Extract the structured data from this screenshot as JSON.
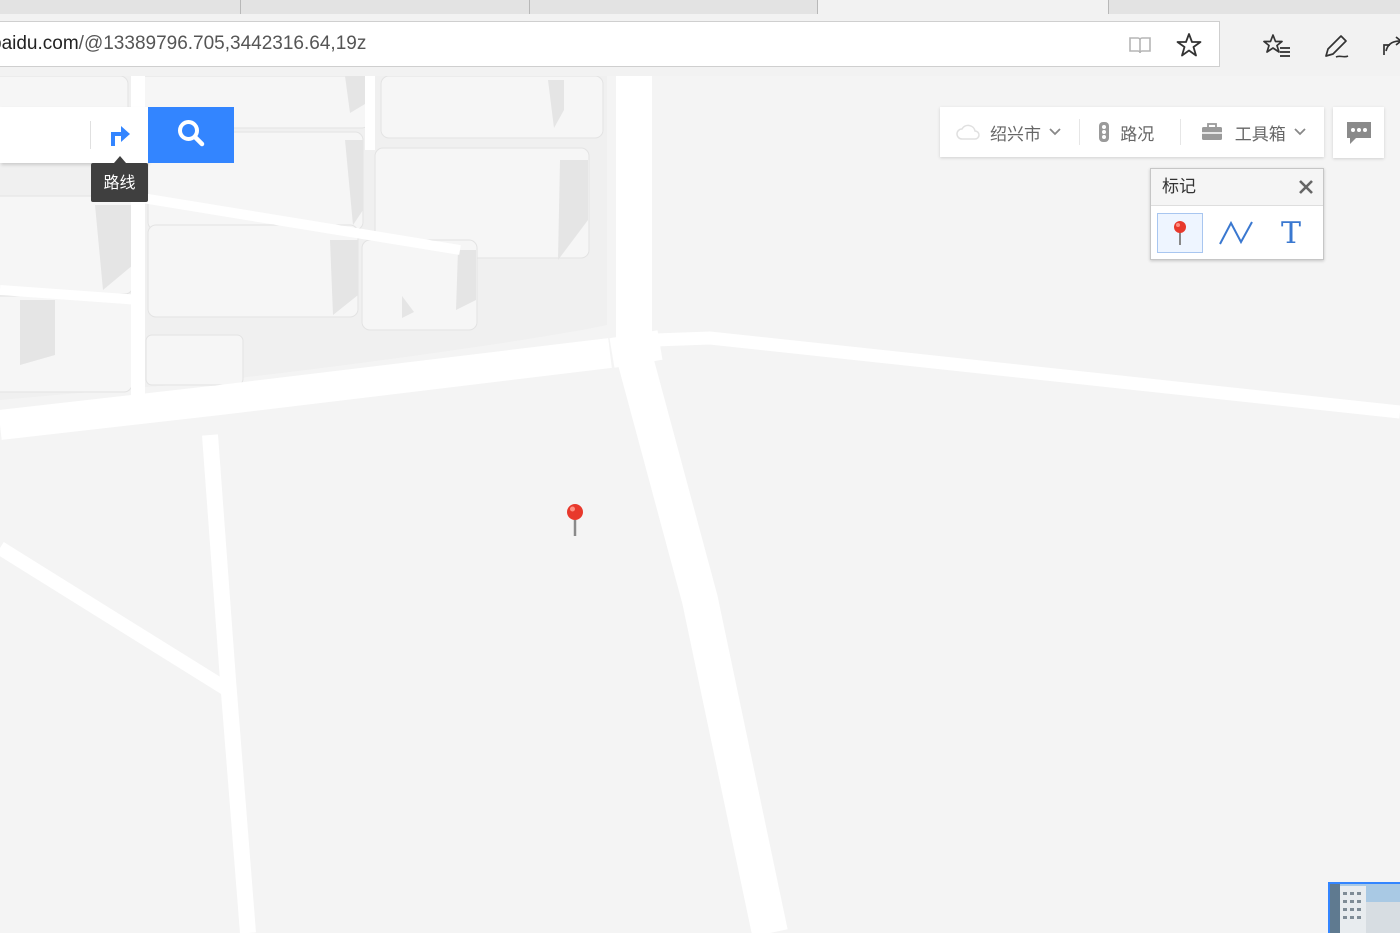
{
  "browser": {
    "url_host": "baidu.com",
    "url_path": "/@13389796.705,3442316.64,19z"
  },
  "search": {
    "input_value": "",
    "route_tooltip": "路线"
  },
  "toolbar": {
    "city": "绍兴市",
    "traffic": "路况",
    "toolbox": "工具箱"
  },
  "mark_panel": {
    "title": "标记",
    "tools": [
      "marker-tool",
      "polyline-tool",
      "text-tool"
    ],
    "text_tool_glyph": "T"
  },
  "colors": {
    "accent": "#3385ff",
    "map_background": "#f4f4f4",
    "road": "#ffffff",
    "building": "#ececec",
    "marker": "#e8392c"
  }
}
